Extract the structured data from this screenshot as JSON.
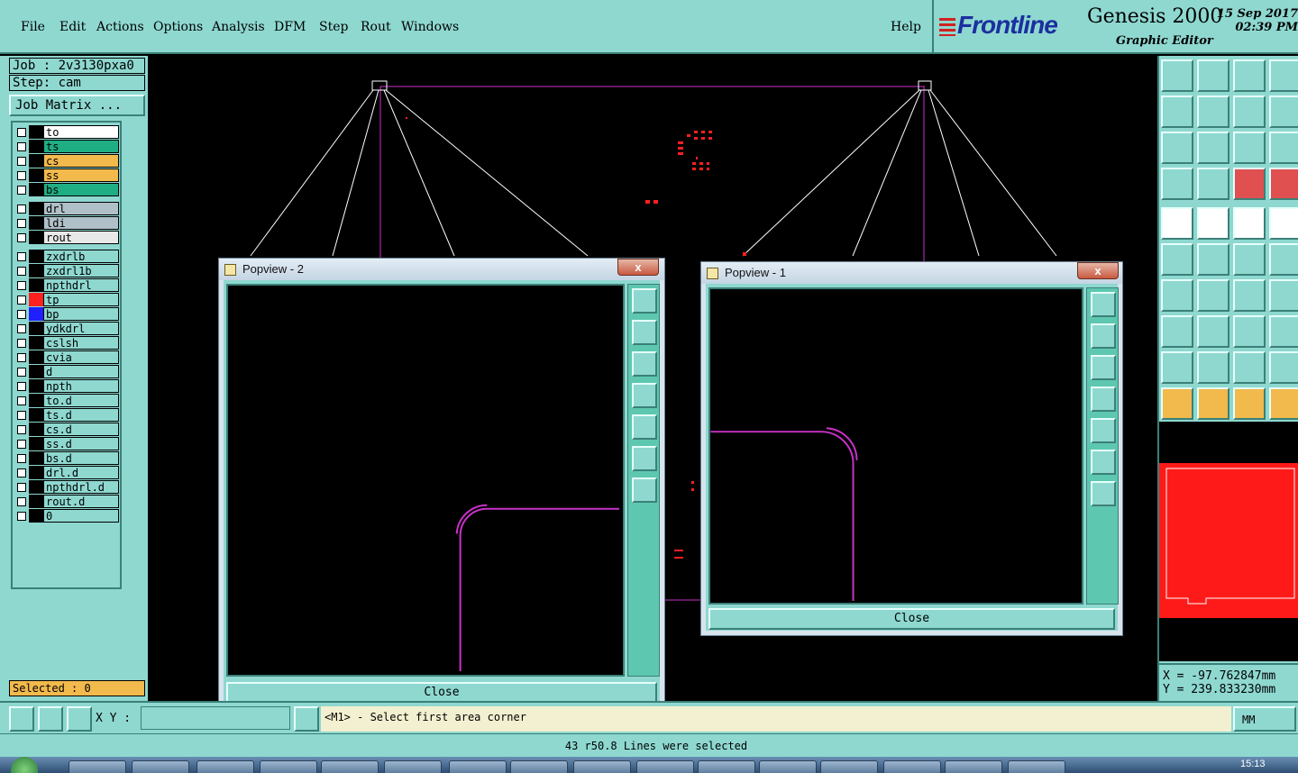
{
  "menu": {
    "file": "File",
    "edit": "Edit",
    "actions": "Actions",
    "options": "Options",
    "analysis": "Analysis",
    "dfm": "DFM",
    "step": "Step",
    "rout": "Rout",
    "windows": "Windows",
    "help": "Help"
  },
  "brand": {
    "company": "Frontline",
    "product": "Genesis 2000",
    "module": "Graphic Editor",
    "date": "15 Sep 2017",
    "time": "02:39 PM"
  },
  "left": {
    "job": "Job : 2v3130pxa0",
    "step": "Step: cam",
    "job_matrix": "Job Matrix ...",
    "selected": "Selected : 0"
  },
  "layers": [
    {
      "name": "to",
      "color": "#ffffff"
    },
    {
      "name": "ts",
      "color": "#1fae84"
    },
    {
      "name": "cs",
      "color": "#f2b94c"
    },
    {
      "name": "ss",
      "color": "#f2b94c"
    },
    {
      "name": "bs",
      "color": "#1fae84"
    },
    {
      "name": "drl",
      "color": "#b0c0c8"
    },
    {
      "name": "ldi",
      "color": "#b0c0c8"
    },
    {
      "name": "rout",
      "color": "#e8e8e8"
    },
    {
      "name": "zxdrlb",
      "color": "#8ed8d0"
    },
    {
      "name": "zxdrl1b",
      "color": "#8ed8d0"
    },
    {
      "name": "npthdrl",
      "color": "#8ed8d0"
    },
    {
      "name": "tp",
      "color": "#8ed8d0",
      "swatch": "#ff2020"
    },
    {
      "name": "bp",
      "color": "#8ed8d0",
      "swatch": "#2020ff"
    },
    {
      "name": "ydkdrl",
      "color": "#8ed8d0"
    },
    {
      "name": "cslsh",
      "color": "#8ed8d0"
    },
    {
      "name": "cvia",
      "color": "#8ed8d0"
    },
    {
      "name": "d",
      "color": "#8ed8d0"
    },
    {
      "name": "npth",
      "color": "#8ed8d0"
    },
    {
      "name": "to.d",
      "color": "#8ed8d0"
    },
    {
      "name": "ts.d",
      "color": "#8ed8d0"
    },
    {
      "name": "cs.d",
      "color": "#8ed8d0"
    },
    {
      "name": "ss.d",
      "color": "#8ed8d0"
    },
    {
      "name": "bs.d",
      "color": "#8ed8d0"
    },
    {
      "name": "drl.d",
      "color": "#8ed8d0"
    },
    {
      "name": "npthdrl.d",
      "color": "#8ed8d0"
    },
    {
      "name": "rout.d",
      "color": "#8ed8d0"
    },
    {
      "name": "0",
      "color": "#8ed8d0"
    }
  ],
  "popview2": {
    "title": "Popview - 2",
    "close": "Close",
    "close_x": "x"
  },
  "popview1": {
    "title": "Popview - 1",
    "close": "Close",
    "close_x": "x"
  },
  "coords": {
    "x": "X = -97.762847mm",
    "y": "Y = 239.833230mm"
  },
  "bottom": {
    "xy_label": "X Y :",
    "xy_value": "",
    "prompt": "<M1> - Select first area corner",
    "units": "MM",
    "status": "43 r50.8 Lines were selected"
  },
  "colors": {
    "panel": "#8ed8d0",
    "profile": "#c832c8",
    "feature": "#ff2020"
  },
  "taskbar": {
    "clock": "15:13"
  }
}
